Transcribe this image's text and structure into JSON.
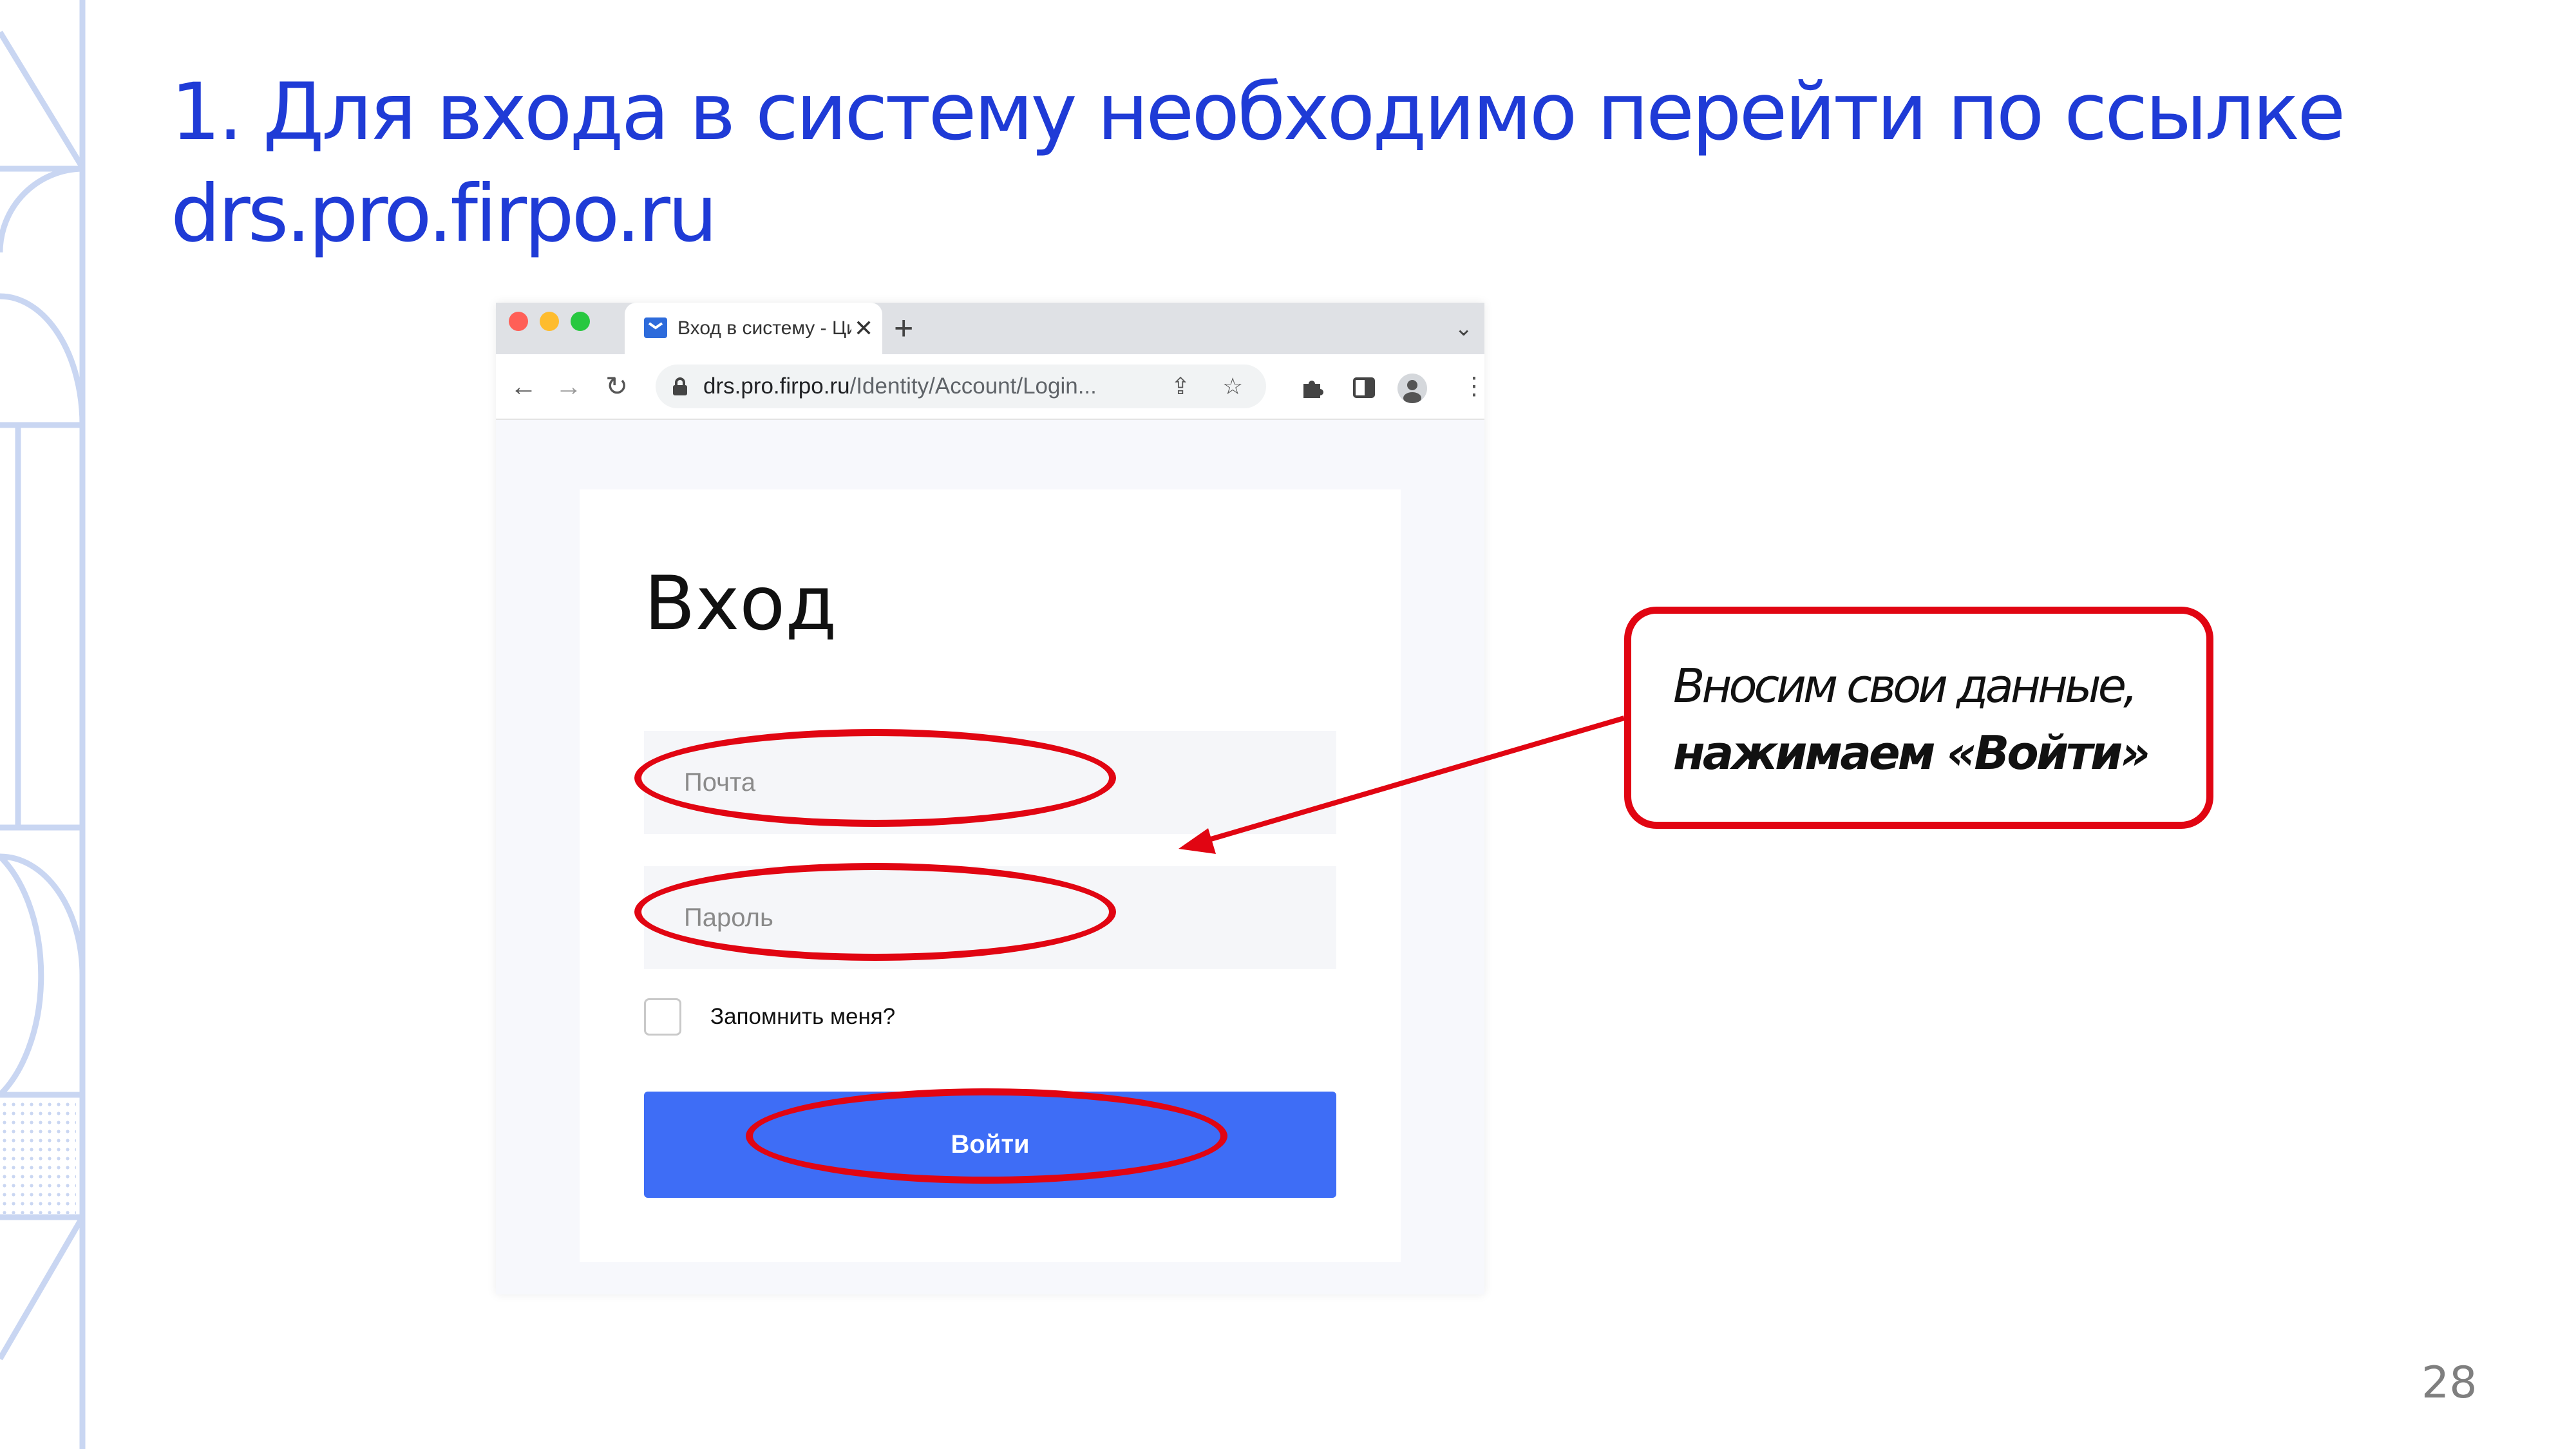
{
  "slide": {
    "title_line1": "1. Для входа в систему необходимо перейти по ссылке",
    "title_line2": "drs.pro.firpo.ru",
    "page_number": "28"
  },
  "browser": {
    "tab_title": "Вход в систему - Цифровая С",
    "tab_close": "✕",
    "new_tab": "+",
    "url_host": "drs.pro.firpo.ru",
    "url_path": "/Identity/Account/Login...",
    "icons": [
      "back-icon",
      "forward-icon",
      "reload-icon",
      "lock-icon",
      "share-icon",
      "star-icon",
      "extensions-icon",
      "side-panel-icon",
      "profile-icon",
      "menu-icon"
    ]
  },
  "login": {
    "heading": "Вход",
    "email_placeholder": "Почта",
    "password_placeholder": "Пароль",
    "remember_label": "Запомнить меня?",
    "submit_label": "Войти"
  },
  "callout": {
    "line1": "Вносим свои данные,",
    "line2": "нажимаем «Войти»"
  },
  "colors": {
    "title": "#1f3bd6",
    "annotation": "#e10512",
    "button": "#3e6df6",
    "decor": "#c9d6f2"
  }
}
